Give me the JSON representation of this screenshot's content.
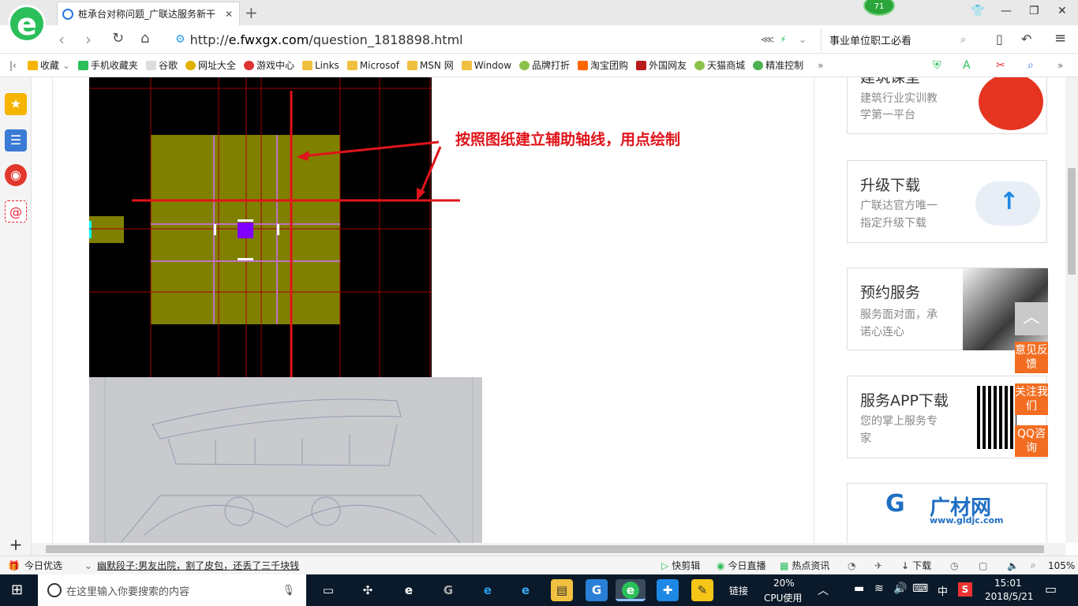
{
  "browser": {
    "tab_title": "桩承台对称问题_广联达服务新干",
    "notif_count": "71",
    "url": "http://e.fwxgx.com/question_1818898.html",
    "url_domain": "e.fwxgx.com",
    "url_prefix": "http://",
    "url_path": "/question_1818898.html",
    "search_text": "事业单位职工必看"
  },
  "bookmarks": [
    {
      "label": "收藏",
      "color": "#f5b400"
    },
    {
      "label": "手机收藏夹",
      "color": "#2bbf5a"
    },
    {
      "label": "谷歌",
      "color": "#cccccc"
    },
    {
      "label": "网址大全",
      "color": "#e0b000"
    },
    {
      "label": "游戏中心",
      "color": "#d33"
    },
    {
      "label": "Links",
      "color": "#f0c040"
    },
    {
      "label": "Microsof",
      "color": "#f0c040"
    },
    {
      "label": "MSN 网",
      "color": "#f0c040"
    },
    {
      "label": "Window",
      "color": "#f0c040"
    },
    {
      "label": "品牌打折",
      "color": "#8bc34a"
    },
    {
      "label": "淘宝团购",
      "color": "#ff6600"
    },
    {
      "label": "外国网友",
      "color": "#b71c1c"
    },
    {
      "label": "天猫商城",
      "color": "#8bc34a"
    },
    {
      "label": "精准控制",
      "color": "#4caf50"
    }
  ],
  "article": {
    "annotation": "按照图纸建立辅助轴线，用点绘制"
  },
  "sidecards": [
    {
      "title": "建筑课堂",
      "sub": [
        "建筑行业实训教",
        "学第一平台"
      ]
    },
    {
      "title": "升级下载",
      "sub": [
        "广联达官方唯一",
        "指定升级下载"
      ]
    },
    {
      "title": "预约服务",
      "sub": [
        "服务面对面，承",
        "诺心连心"
      ]
    },
    {
      "title": "服务APP下载",
      "sub": [
        "您的掌上服务专",
        "家"
      ]
    }
  ],
  "ad_brand": "广材网",
  "ad_url": "www.gldjc.com",
  "float_buttons": [
    "意见反馈",
    "关注我们",
    "QQ咨询"
  ],
  "statusbar": {
    "today_pick": "今日优选",
    "news": "幽默段子:男友出院，割了皮包，还丢了三千块钱",
    "items": [
      "快剪辑",
      "今日直播",
      "热点资讯",
      "下载"
    ],
    "zoom": "105%"
  },
  "taskbar": {
    "search_placeholder": "在这里输入你要搜索的内容",
    "link_label": "链接",
    "cpu_percent": "20%",
    "cpu_label": "CPU使用",
    "ime": "中",
    "time": "15:01",
    "date": "2018/5/21"
  },
  "colors": {
    "accent_green": "#2bbf5a",
    "annotation_red": "#e0141b",
    "float_orange": "#f26d21",
    "cad_slab": "#808000"
  }
}
